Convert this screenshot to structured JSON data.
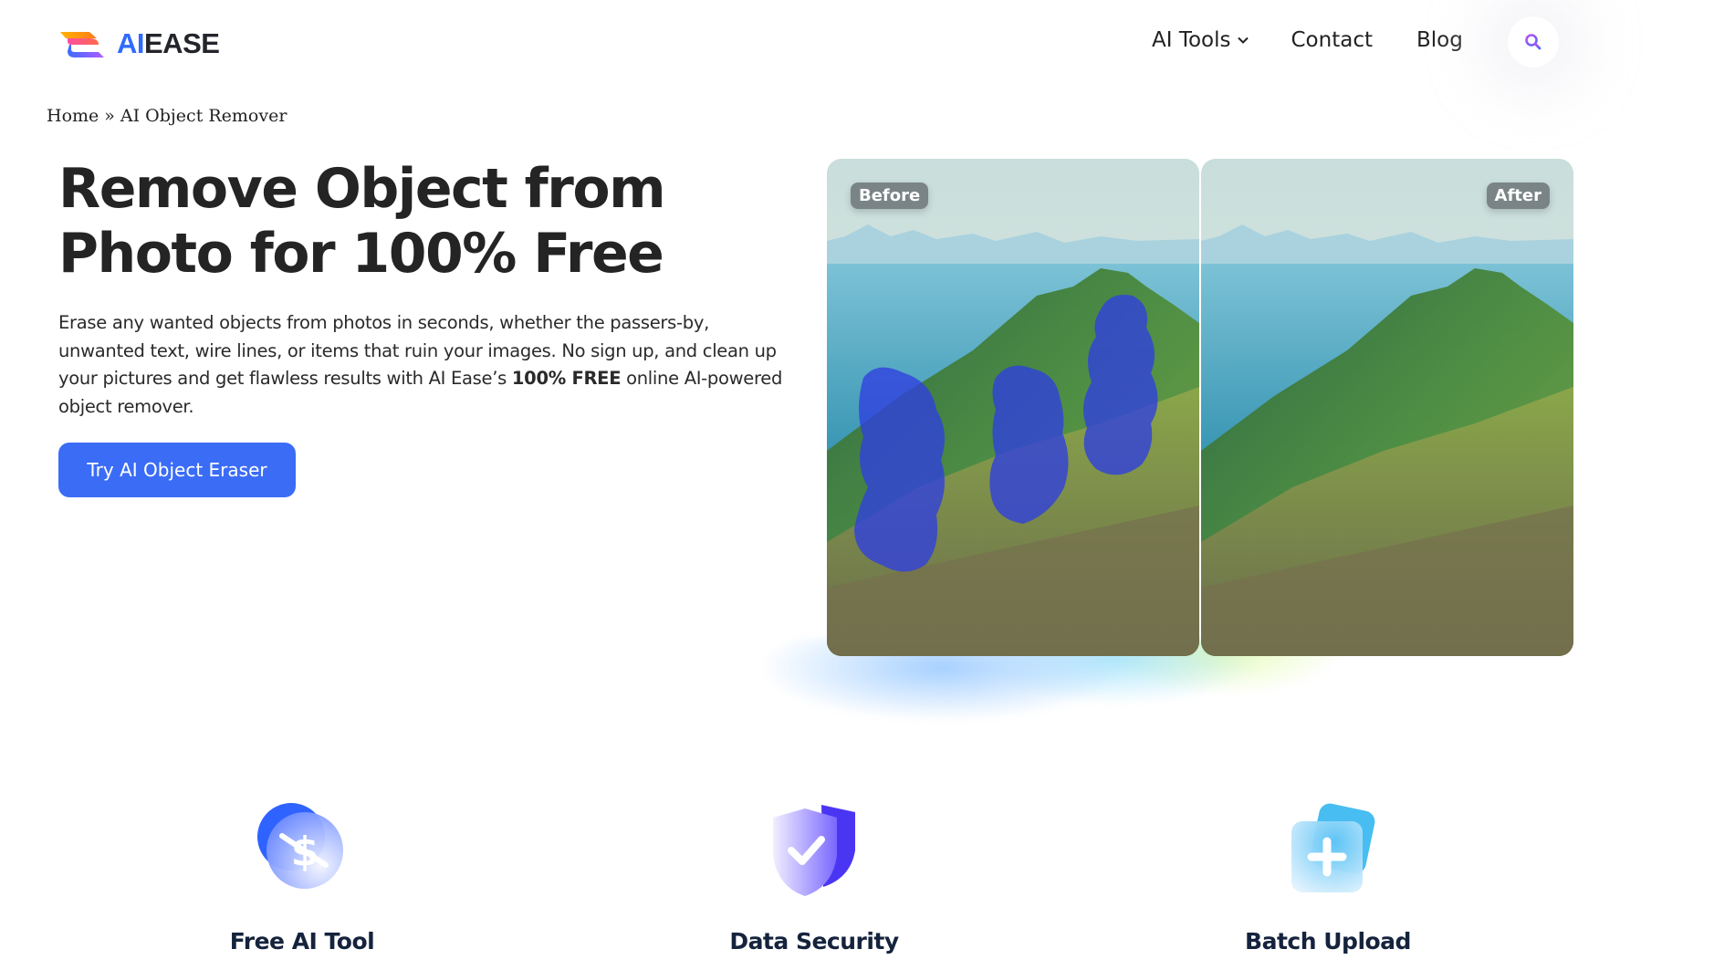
{
  "brand": {
    "logo_ai": "AI",
    "logo_ease": "EASE",
    "accent_color": "#2f6bff"
  },
  "nav": {
    "items": [
      {
        "label": "AI Tools",
        "has_dropdown": true
      },
      {
        "label": "Contact"
      },
      {
        "label": "Blog"
      }
    ],
    "search_icon": "search-icon"
  },
  "breadcrumb": {
    "home": "Home",
    "separator": "»",
    "current": "AI Object Remover"
  },
  "hero": {
    "title_line1": "Remove Object from",
    "title_line2": "Photo for 100% Free",
    "description_before_bold": "Erase any wanted objects from photos in seconds, whether the passers-by, unwanted text, wire lines, or items that ruin your images. No sign up, and clean up your pictures and get flawless results with AI Ease’s ",
    "description_bold": "100% FREE",
    "description_after_bold": " online AI-powered object remover.",
    "cta_label": "Try AI Object Eraser",
    "cta_color": "#3b6cf6"
  },
  "comparison": {
    "before_label": "Before",
    "after_label": "After",
    "mask_color": "#2f3fe0"
  },
  "features": [
    {
      "label": "Free AI Tool",
      "icon": "no-dollar-icon"
    },
    {
      "label": "Data Security",
      "icon": "shield-check-icon"
    },
    {
      "label": "Batch Upload",
      "icon": "batch-upload-icon"
    }
  ]
}
